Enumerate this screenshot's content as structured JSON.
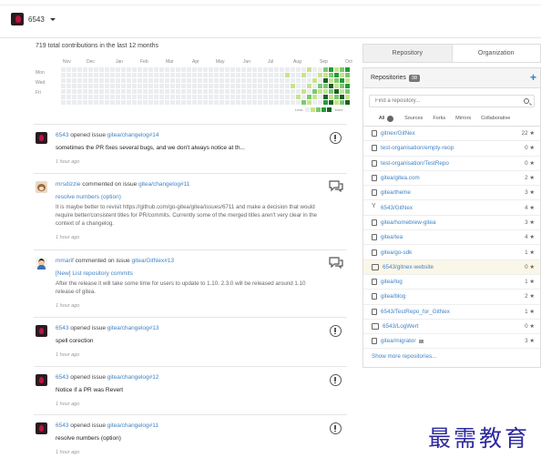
{
  "context": {
    "name": "6543"
  },
  "heatmap": {
    "title": "719 total contributions in the last 12 months",
    "months": [
      "Nov",
      "Dec",
      "Jan",
      "Feb",
      "Mar",
      "Apr",
      "May",
      "Jun",
      "Jul",
      "Aug",
      "Sep",
      "Oct"
    ],
    "days": [
      "Mon",
      "Wed",
      "Fri"
    ],
    "legend_less": "Less",
    "legend_more": "More",
    "colors": [
      "#ebedf0",
      "#c6e48b",
      "#7bc96f",
      "#239a3b",
      "#196127"
    ]
  },
  "feed": [
    {
      "user": "6543",
      "action": "opened issue",
      "link": "gitea/changelog#14",
      "title": "sometimes the PR fixes several bugs, and we don't always notice at th...",
      "title_link": false,
      "body": "",
      "time": "1 hour ago",
      "icon": "issue-opened-icon",
      "avatar": "dark"
    },
    {
      "user": "mrsdizzie",
      "action": "commented on issue",
      "link": "gitea/changelog#11",
      "title": "resolve numbers (option)",
      "title_link": true,
      "body": "It is maybe better to revisit https://github.com/go-gitea/gitea/issues/6711 and make a decision that would require better/consistent titles for PR/commits. Currently some of the merged titles aren't very clear in the context of a changelog.",
      "time": "1 hour ago",
      "icon": "comment-icon",
      "avatar": "cat"
    },
    {
      "user": "mmarif",
      "action": "commented on issue",
      "link": "gitea/GitNex#13",
      "title": "[New] List repository commits",
      "title_link": true,
      "body": "After the release it will take some time for users to update to 1.10. 2.3.0 will be released around 1.10 release of gitea.",
      "time": "1 hour ago",
      "icon": "comment-icon",
      "avatar": "man"
    },
    {
      "user": "6543",
      "action": "opened issue",
      "link": "gitea/changelog#13",
      "title": "spell corection",
      "title_link": false,
      "body": "",
      "time": "1 hour ago",
      "icon": "issue-opened-icon",
      "avatar": "dark"
    },
    {
      "user": "6543",
      "action": "opened issue",
      "link": "gitea/changelog#12",
      "title": "Notice if a PR was Revert",
      "title_link": false,
      "body": "",
      "time": "1 hour ago",
      "icon": "issue-opened-icon",
      "avatar": "dark"
    },
    {
      "user": "6543",
      "action": "opened issue",
      "link": "gitea/changelog#11",
      "title": "resolve numbers (option)",
      "title_link": false,
      "body": "",
      "time": "1 hour ago",
      "icon": "issue-opened-icon",
      "avatar": "dark"
    }
  ],
  "sidebar": {
    "tabs": [
      "Repository",
      "Organization"
    ],
    "repositories_label": "Repositories",
    "repositories_count": "38",
    "search_placeholder": "Find a repository...",
    "filters": {
      "all": "All",
      "sources": "Sources",
      "forks": "Forks",
      "mirrors": "Mirrors",
      "collaborative": "Collaborative"
    },
    "repos": [
      {
        "name": "gitnex/GitNex",
        "stars": "22 ★",
        "type": "repo"
      },
      {
        "name": "test-organisation/empty-reop",
        "stars": "0 ★",
        "type": "repo"
      },
      {
        "name": "test-organisation/TestRepo",
        "stars": "0 ★",
        "type": "repo"
      },
      {
        "name": "gitea/gitea.com",
        "stars": "2 ★",
        "type": "repo"
      },
      {
        "name": "gitea/theme",
        "stars": "3 ★",
        "type": "repo"
      },
      {
        "name": "6543/GitNex",
        "stars": "4 ★",
        "type": "fork"
      },
      {
        "name": "gitea/homebrew-gitea",
        "stars": "3 ★",
        "type": "repo"
      },
      {
        "name": "gitea/tea",
        "stars": "4 ★",
        "type": "repo"
      },
      {
        "name": "gitea/go-sdk",
        "stars": "1 ★",
        "type": "repo"
      },
      {
        "name": "6543/gitnex-website",
        "stars": "0 ★",
        "type": "mirror",
        "highlight": true
      },
      {
        "name": "gitea/log",
        "stars": "1 ★",
        "type": "repo"
      },
      {
        "name": "gitea/blog",
        "stars": "2 ★",
        "type": "repo"
      },
      {
        "name": "6543/TestRepo_for_GitNex",
        "stars": "1 ★",
        "type": "repo"
      },
      {
        "name": "6543/LogWert",
        "stars": "0 ★",
        "type": "mirror"
      },
      {
        "name": "gitea/migrator",
        "stars": "3 ★",
        "type": "repo",
        "locked": true
      }
    ],
    "show_more": "Show more repositories..."
  },
  "watermark": "最需教育"
}
